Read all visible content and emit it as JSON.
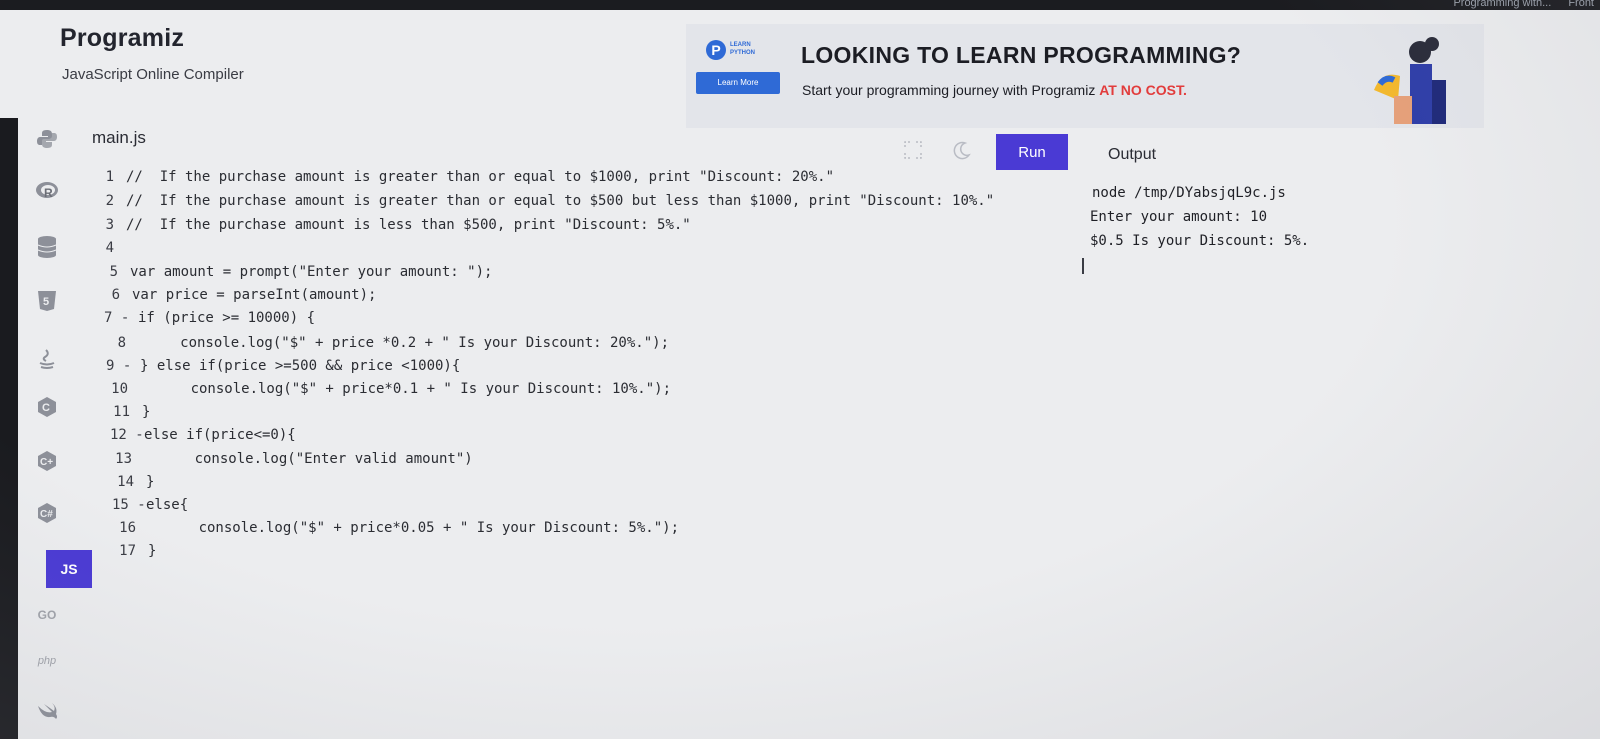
{
  "browser": {
    "tab_partial": "Programming with...",
    "tab_partial_2": "Front"
  },
  "brand": {
    "logo_text": "Programiz",
    "subtitle": "JavaScript Online Compiler"
  },
  "ad": {
    "logo_label": "LEARN PYTHON",
    "learn_more": "Learn More",
    "headline": "LOOKING TO LEARN PROGRAMMING?",
    "sub_prefix": "Start your programming journey with Programiz ",
    "sub_highlight": "AT NO COST.",
    "highlight_color": "#e23c3c"
  },
  "sidebar": {
    "items": [
      {
        "icon": "python-icon"
      },
      {
        "icon": "r-language-icon"
      },
      {
        "icon": "sql-database-icon"
      },
      {
        "icon": "html5-icon"
      },
      {
        "icon": "java-icon"
      },
      {
        "icon": "c-language-icon"
      },
      {
        "icon": "cpp-language-icon"
      },
      {
        "icon": "csharp-language-icon"
      },
      {
        "icon": "js-icon",
        "label": "JS",
        "active": true
      },
      {
        "icon": "go-language-icon",
        "label": "GO"
      },
      {
        "icon": "php-icon",
        "label": "php"
      },
      {
        "icon": "swift-icon"
      }
    ]
  },
  "editor": {
    "file_name": "main.js",
    "run_label": "Run",
    "accent": "#4a3ad4",
    "lines": [
      {
        "n": "1",
        "text": "//  If the purchase amount is greater than or equal to $1000, print \"Discount: 20%.\""
      },
      {
        "n": "2",
        "text": "//  If the purchase amount is greater than or equal to $500 but less than $1000, print \"Discount: 10%.\""
      },
      {
        "n": "3",
        "text": "//  If the purchase amount is less than $500, print \"Discount: 5%.\""
      },
      {
        "n": "4",
        "text": ""
      },
      {
        "n": "5",
        "text": "var amount = prompt(\"Enter your amount: \");"
      },
      {
        "n": "6",
        "text": "var price = parseInt(amount);"
      },
      {
        "n": "7 -",
        "text": "if (price >= 10000) {"
      },
      {
        "n": "8",
        "text": "     console.log(\"$\" + price *0.2 + \" Is your Discount: 20%.\");"
      },
      {
        "n": "9 -",
        "text": "} else if(price >=500 && price <1000){"
      },
      {
        "n": "10",
        "text": "      console.log(\"$\" + price*0.1 + \" Is your Discount: 10%.\");"
      },
      {
        "n": "11",
        "text": "}"
      },
      {
        "n": "12 -",
        "text": "else if(price<=0){"
      },
      {
        "n": "13",
        "text": "      console.log(\"Enter valid amount\")"
      },
      {
        "n": "14",
        "text": "}"
      },
      {
        "n": "15 -",
        "text": "else{"
      },
      {
        "n": "16",
        "text": "      console.log(\"$\" + price*0.05 + \" Is your Discount: 5%.\");"
      },
      {
        "n": "17",
        "text": "}"
      }
    ]
  },
  "output": {
    "title": "Output",
    "lines": [
      "node /tmp/DYabsjqL9c.js",
      "Enter your amount: 10",
      "$0.5 Is your Discount: 5%."
    ]
  }
}
